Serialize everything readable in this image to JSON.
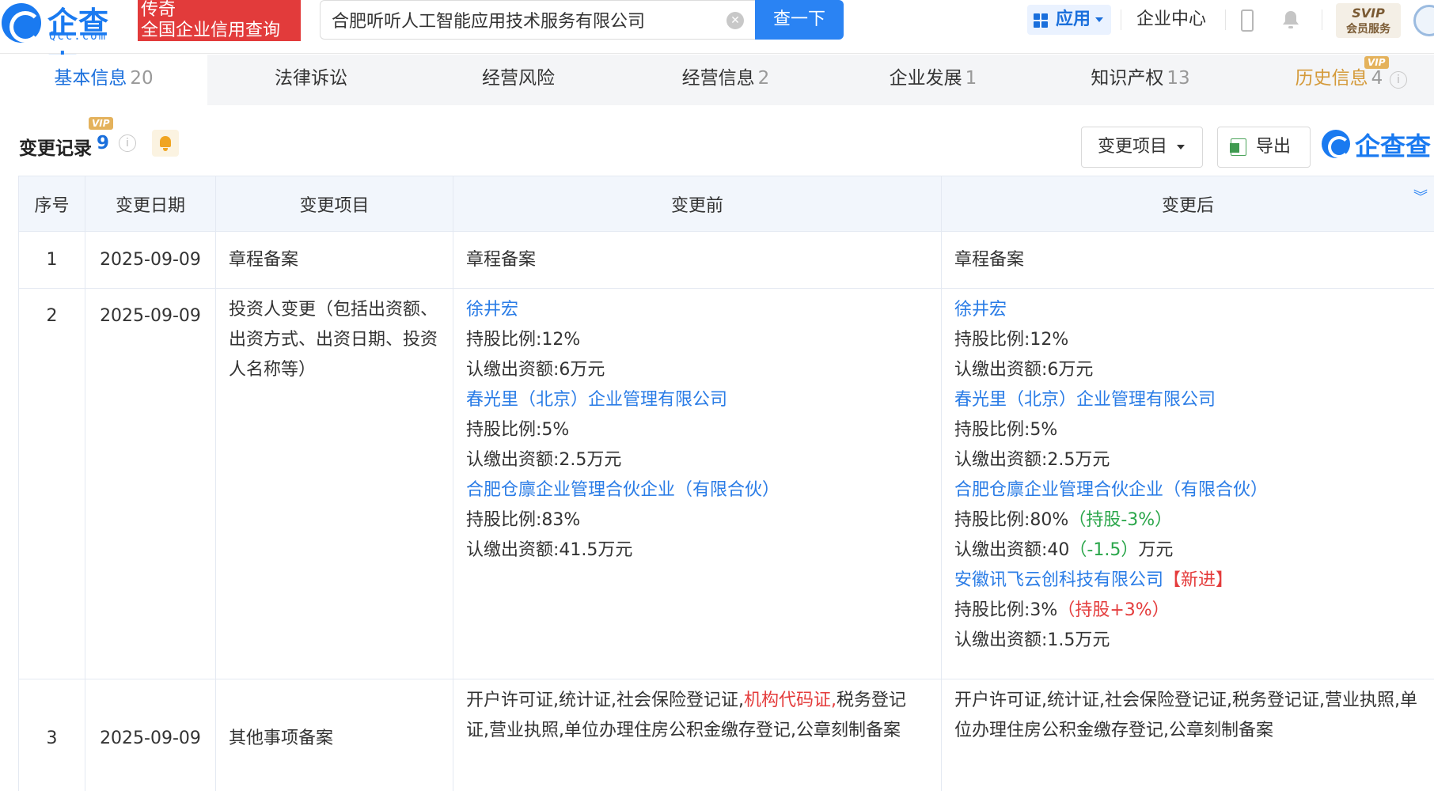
{
  "header": {
    "logo_text": "企查查",
    "logo_sub": "Qcc.com",
    "tag_line1": "传奇",
    "tag_line2": "全国企业信用查询",
    "search_value": "合肥听听人工智能应用技术服务有限公司",
    "search_button": "查一下",
    "app_button": "应用",
    "enterprise_center": "企业中心",
    "svip_line1": "SVIP",
    "svip_line2": "会员服务"
  },
  "tabs": [
    {
      "label": "基本信息",
      "count": "20"
    },
    {
      "label": "法律诉讼",
      "count": ""
    },
    {
      "label": "经营风险",
      "count": ""
    },
    {
      "label": "经营信息",
      "count": "2"
    },
    {
      "label": "企业发展",
      "count": "1"
    },
    {
      "label": "知识产权",
      "count": "13"
    },
    {
      "label": "历史信息",
      "count": "4"
    }
  ],
  "vip_label": "VIP",
  "section": {
    "title": "变更记录",
    "count": "9",
    "filter_button": "变更项目",
    "export_button": "导出",
    "watermark_logo": "企查查"
  },
  "table": {
    "headers": [
      "序号",
      "变更日期",
      "变更项目",
      "变更前",
      "变更后"
    ],
    "rows": [
      {
        "no": "1",
        "date": "2025-09-09",
        "item": "章程备案",
        "before": "章程备案",
        "after": "章程备案"
      },
      {
        "no": "2",
        "date": "2025-09-09",
        "item": "投资人变更（包括出资额、出资方式、出资日期、投资人名称等）",
        "before": {
          "inv1_name": "徐井宏",
          "inv1_ratio": "持股比例:12%",
          "inv1_amount": "认缴出资额:6万元",
          "inv2_name": "春光里（北京）企业管理有限公司",
          "inv2_ratio": "持股比例:5%",
          "inv2_amount": "认缴出资额:2.5万元",
          "inv3_name": "合肥仓廪企业管理合伙企业（有限合伙）",
          "inv3_ratio": "持股比例:83%",
          "inv3_amount": "认缴出资额:41.5万元"
        },
        "after": {
          "inv1_name": "徐井宏",
          "inv1_ratio": "持股比例:12%",
          "inv1_amount": "认缴出资额:6万元",
          "inv2_name": "春光里（北京）企业管理有限公司",
          "inv2_ratio": "持股比例:5%",
          "inv2_amount": "认缴出资额:2.5万元",
          "inv3_name": "合肥仓廪企业管理合伙企业（有限合伙）",
          "inv3_ratio": "持股比例:80%",
          "inv3_ratio_delta": "（持股-3%）",
          "inv3_amount_prefix": "认缴出资额:40",
          "inv3_amount_delta": "（-1.5）",
          "inv3_amount_suffix": "万元",
          "inv4_name": "安徽讯飞云创科技有限公司",
          "inv4_tag": "【新进】",
          "inv4_ratio": "持股比例:3%",
          "inv4_ratio_delta": "（持股+3%）",
          "inv4_amount": "认缴出资额:1.5万元"
        }
      },
      {
        "no": "3",
        "date": "2025-09-09",
        "item": "其他事项备案",
        "before_part1": "开户许可证,统计证,社会保险登记证,",
        "before_removed": "机构代码证,",
        "before_part2": "税务登记证,营业执照,单位办理住房公积金缴存登记,公章刻制备案",
        "after": "开户许可证,统计证,社会保险登记证,税务登记证,营业执照,单位办理住房公积金缴存登记,公章刻制备案"
      }
    ]
  }
}
